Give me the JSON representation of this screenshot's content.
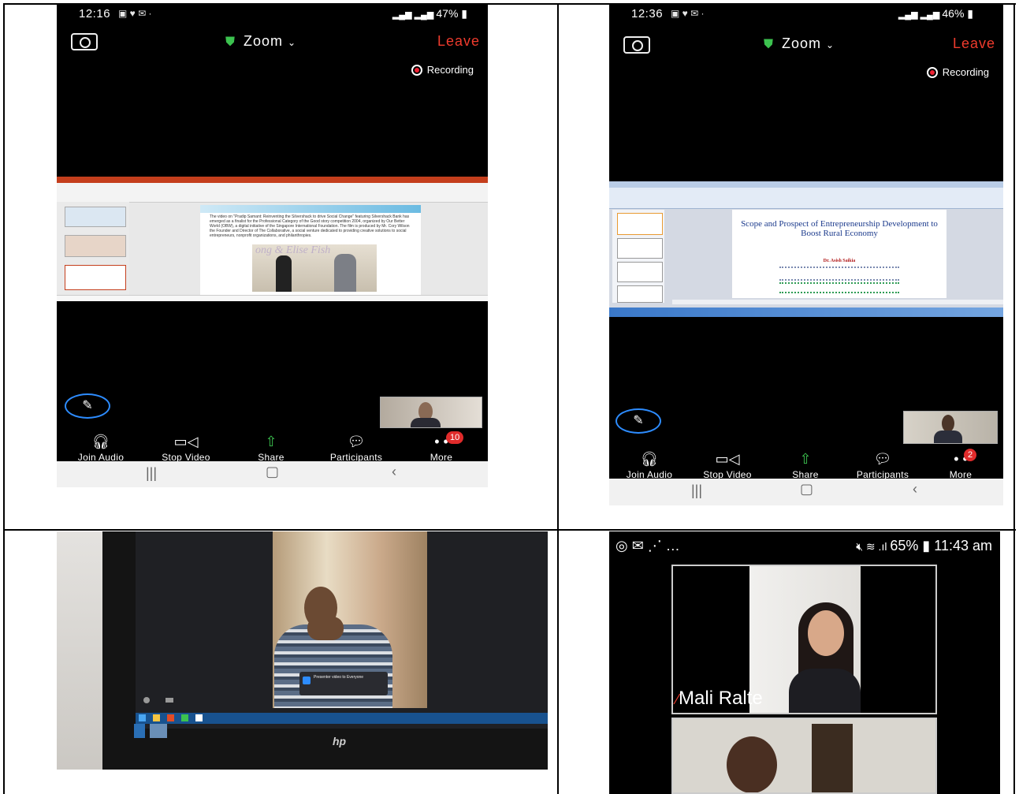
{
  "panel1": {
    "status": {
      "time": "12:16",
      "right": "47%"
    },
    "header": {
      "title": "Zoom",
      "leave": "Leave",
      "recording": "Recording"
    },
    "slide": {
      "text": "The video on \"Pradip Samant: Reinventing the Silvershack to drive Social Change\" featuring Silvershack Bank has emerged as a finalist for the Professional Category of the Good story competition 2004, organized by Our Better World (OBW), a digital initiative of the Singapore International Foundation. The film is produced by Mr. Cory Wilson the Founder and Director of The Collaborative, a social venture dedicated to providing creative solutions to social entrepreneurs, nonprofit organizations, and philanthropies.",
      "watermark": "ong & Elise Fish"
    },
    "toolbar": {
      "join_audio": "Join Audio",
      "stop_video": "Stop Video",
      "share": "Share",
      "participants": "Participants",
      "more": "More",
      "more_badge": "10"
    }
  },
  "panel2": {
    "status": {
      "time": "12:36",
      "right": "46%"
    },
    "header": {
      "title": "Zoom",
      "leave": "Leave",
      "recording": "Recording"
    },
    "slide": {
      "title": "Scope and Prospect of Entrepreneurship Development to Boost Rural Economy",
      "author": "Dr. Asish Saikia"
    },
    "toolbar": {
      "join_audio": "Join Audio",
      "stop_video": "Stop Video",
      "share": "Share",
      "participants": "Participants",
      "more": "More",
      "more_badge": "2"
    }
  },
  "panel3": {
    "notification": "Presenter video to Everyone",
    "monitor_brand": "hp"
  },
  "panel4": {
    "status": {
      "battery": "65%",
      "time": "11:43 am"
    },
    "participant_name": "Mali Ralte"
  },
  "colors": {
    "leave": "#ef3b2d",
    "zoom_blue": "#2d8cff",
    "shield_green": "#3cc24f",
    "badge_red": "#e02b2b"
  }
}
